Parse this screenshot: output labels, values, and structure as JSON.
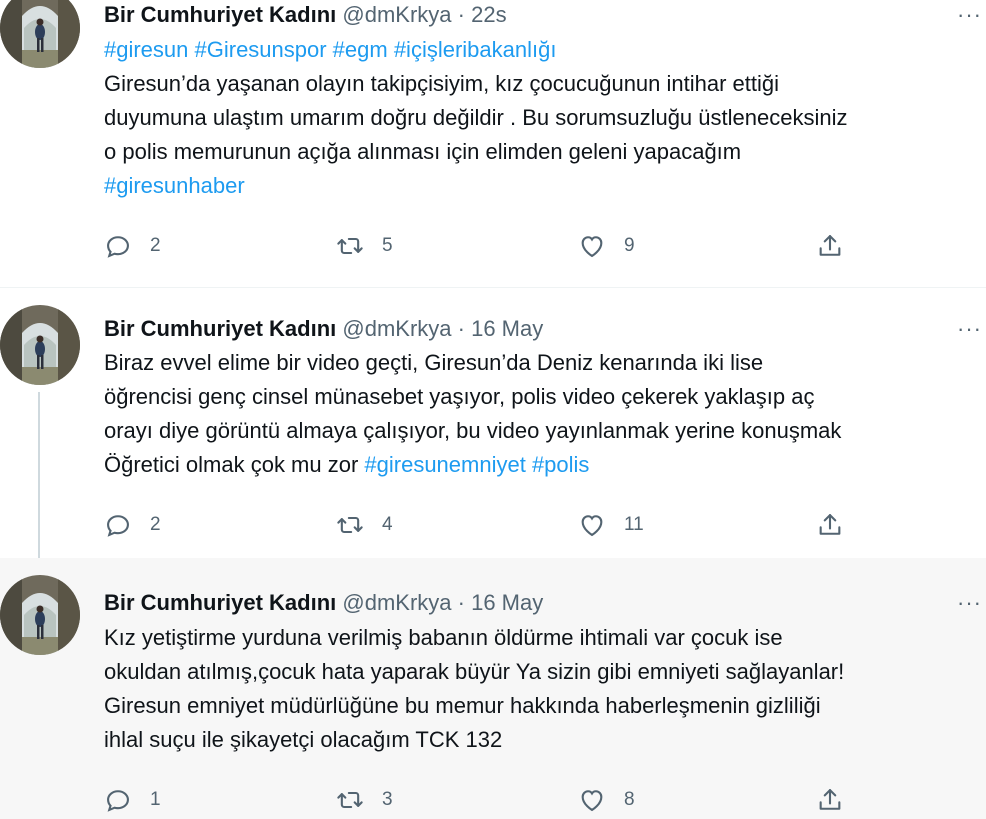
{
  "tweets": [
    {
      "name": "Bir Cumhuriyet Kadını",
      "handle": "@dmKrkya",
      "separator": "·",
      "time": "22s",
      "more": "···",
      "lines": [
        [
          {
            "t": "#giresun #Giresunspor #egm #içişleribakanlığı",
            "tag": true
          }
        ],
        [
          {
            "t": "Giresun’da yaşanan olayın takipçisiyim,  kız çocucuğunun intihar ettiği",
            "tag": false
          }
        ],
        [
          {
            "t": "duyumuna ulaştım umarım doğru değildir . Bu sorumsuzluğu üstleneceksiniz",
            "tag": false
          }
        ],
        [
          {
            "t": "o polis memurunun açığa alınması için elimden geleni yapacağım",
            "tag": false
          }
        ],
        [
          {
            "t": "#giresunhaber",
            "tag": true
          }
        ]
      ],
      "replies": "2",
      "retweets": "5",
      "likes": "9"
    },
    {
      "name": "Bir Cumhuriyet Kadını",
      "handle": "@dmKrkya",
      "separator": "·",
      "time": "16 May",
      "more": "···",
      "lines": [
        [
          {
            "t": "Biraz evvel elime bir video geçti, Giresun’da Deniz kenarında iki lise",
            "tag": false
          }
        ],
        [
          {
            "t": "öğrencisi genç  cinsel münasebet yaşıyor, polis video çekerek yaklaşıp aç",
            "tag": false
          }
        ],
        [
          {
            "t": "orayı diye görüntü almaya çalışıyor, bu video yayınlanmak yerine konuşmak",
            "tag": false
          }
        ],
        [
          {
            "t": "Öğretici olmak çok mu zor ",
            "tag": false
          },
          {
            "t": "#giresunemniyet #polis",
            "tag": true
          }
        ]
      ],
      "replies": "2",
      "retweets": "4",
      "likes": "11"
    },
    {
      "name": "Bir Cumhuriyet Kadını",
      "handle": "@dmKrkya",
      "separator": "·",
      "time": "16 May",
      "more": "···",
      "lines": [
        [
          {
            "t": "Kız yetiştirme yurduna verilmiş babanın öldürme ihtimali var çocuk ise",
            "tag": false
          }
        ],
        [
          {
            "t": "okuldan atılmış,çocuk hata yaparak büyür Ya sizin gibi emniyeti sağlayanlar!",
            "tag": false
          }
        ],
        [
          {
            "t": "Giresun emniyet müdürlüğüne bu memur hakkında haberleşmenin gizliliği",
            "tag": false
          }
        ],
        [
          {
            "t": "ihlal suçu ile şikayetçi olacağım TCK 132",
            "tag": false
          }
        ]
      ],
      "replies": "1",
      "retweets": "3",
      "likes": "8"
    }
  ],
  "colors": {
    "accent": "#1d9bf0",
    "muted": "#536471",
    "text": "#0f1419",
    "highlight_bg": "#f7f7f7"
  },
  "icons": [
    "reply-icon",
    "retweet-icon",
    "like-icon",
    "share-icon",
    "more-icon"
  ]
}
